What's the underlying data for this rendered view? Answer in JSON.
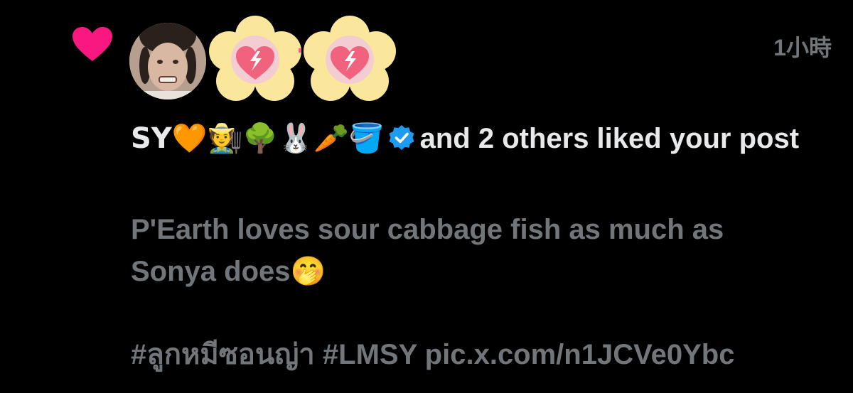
{
  "notification": {
    "timestamp": "1小時",
    "liker_name": "SY🧡🧑‍🌾🌳🐰🥕🪣",
    "liker_suffix": "and 2 others liked your post",
    "post_line_1": "P'Earth loves sour cabbage fish as much as",
    "post_line_2": "Sonya does",
    "post_emoji": "🤭",
    "post_hashtag_thai": "#ลูกหมีซอนญ่า",
    "post_hashtag_lmsy": "#LMSY",
    "post_link": "pic.x.com/n1JCVe0Ybc"
  },
  "icons": {
    "like": "heart-icon",
    "verified": "verified-badge-icon"
  },
  "colors": {
    "background": "#000000",
    "heart": "#f91880",
    "primary_text": "#e7e9ea",
    "secondary_text": "#71767b",
    "verified": "#1d9bf0"
  }
}
